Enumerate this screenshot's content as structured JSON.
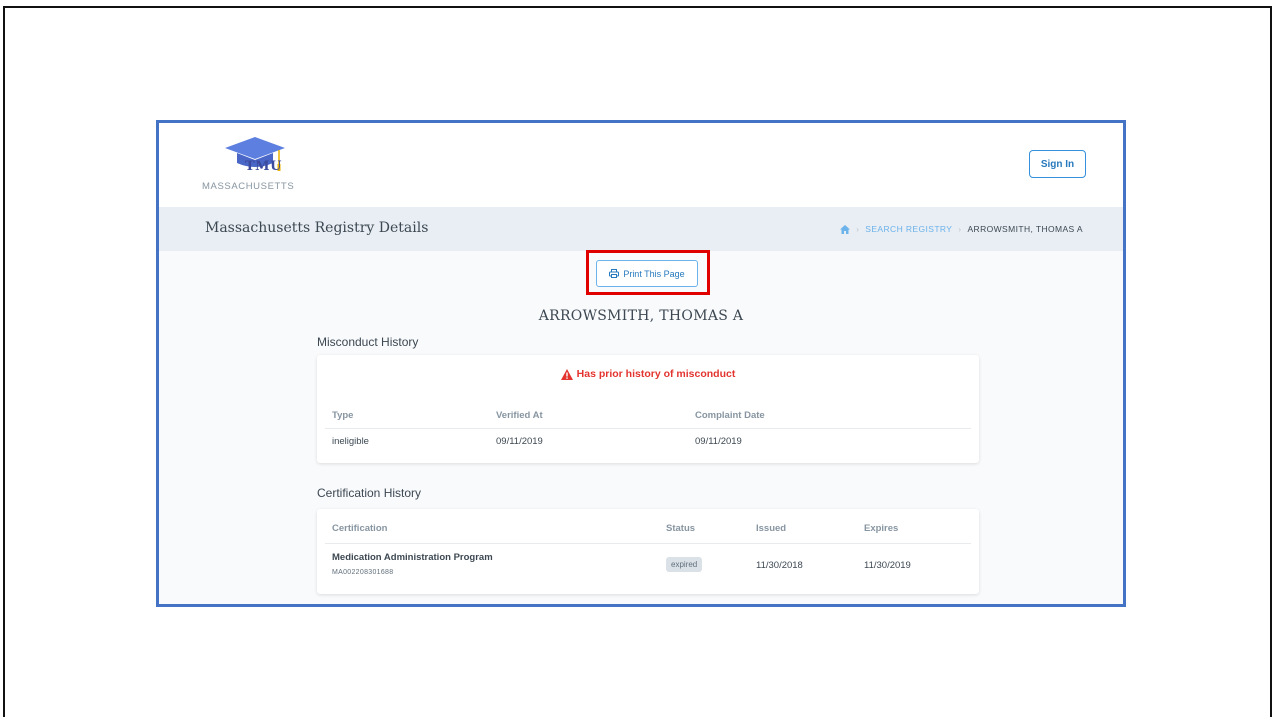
{
  "header": {
    "logo_text": "TMU",
    "logo_subtitle": "MASSACHUSETTS",
    "signin_label": "Sign In"
  },
  "titlebar": {
    "page_title": "Massachusetts Registry Details",
    "breadcrumb": {
      "home_icon": "home-icon",
      "items": [
        "SEARCH REGISTRY",
        "ARROWSMITH, THOMAS A"
      ]
    }
  },
  "content": {
    "print_label": "Print This Page",
    "person_name": "ARROWSMITH, THOMAS A",
    "misconduct": {
      "section_title": "Misconduct History",
      "alert": "Has prior history of misconduct",
      "columns": [
        "Type",
        "Verified At",
        "Complaint Date"
      ],
      "rows": [
        {
          "type": "ineligible",
          "verified_at": "09/11/2019",
          "complaint_date": "09/11/2019"
        }
      ]
    },
    "certification": {
      "section_title": "Certification History",
      "columns": [
        "Certification",
        "Status",
        "Issued",
        "Expires"
      ],
      "rows": [
        {
          "name": "Medication Administration Program",
          "id": "MA002208301688",
          "status": "expired",
          "issued": "11/30/2018",
          "expires": "11/30/2019"
        }
      ]
    }
  },
  "colors": {
    "frame_border": "#4472c4",
    "highlight": "#e00000",
    "accent": "#3490dc",
    "alert": "#e3342f",
    "titlebar_bg": "#e8eef3"
  }
}
